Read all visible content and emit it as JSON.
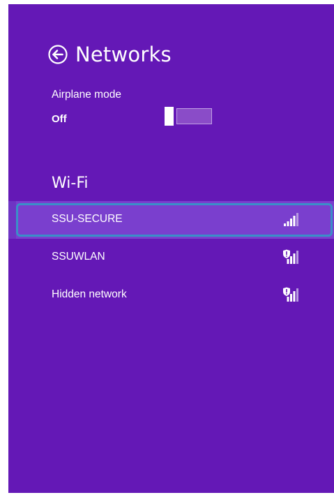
{
  "header": {
    "title": "Networks",
    "back_icon": "back-arrow-circle-icon"
  },
  "airplane": {
    "label": "Airplane mode",
    "state": "Off",
    "enabled": false
  },
  "wifi": {
    "heading": "Wi-Fi",
    "networks": [
      {
        "name": "SSU-SECURE",
        "secured": false,
        "selected": true,
        "icon": "signal-strength-icon"
      },
      {
        "name": "SSUWLAN",
        "secured": true,
        "selected": false,
        "icon": "secured-signal-icon"
      },
      {
        "name": "Hidden network",
        "secured": true,
        "selected": false,
        "icon": "secured-signal-icon"
      }
    ]
  },
  "colors": {
    "background": "#6418b6",
    "selected_row": "#7a3fce",
    "focus_border": "#3a8fc8",
    "text": "#ffffff"
  }
}
